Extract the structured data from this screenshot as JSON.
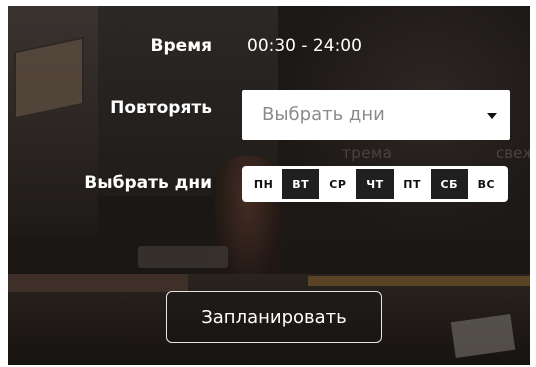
{
  "form": {
    "time_label": "Время",
    "time_value": "00:30 - 24:00",
    "repeat_label": "Повторять",
    "repeat_select": {
      "value": "Выбрать дни"
    },
    "days_label": "Выбрать дни",
    "days": [
      {
        "label": "ПН",
        "selected": false
      },
      {
        "label": "ВТ",
        "selected": true
      },
      {
        "label": "СР",
        "selected": false
      },
      {
        "label": "ЧТ",
        "selected": true
      },
      {
        "label": "ПТ",
        "selected": false
      },
      {
        "label": "СБ",
        "selected": true
      },
      {
        "label": "ВС",
        "selected": false
      }
    ],
    "schedule_button": "Запланировать"
  },
  "background_signs": {
    "left": "трема",
    "right": "свеж"
  },
  "colors": {
    "overlay": "#1b1714",
    "text": "#ffffff",
    "day_selected_bg": "#1f1f1f",
    "day_unselected_bg": "#ffffff",
    "placeholder": "#8b8b8b"
  }
}
